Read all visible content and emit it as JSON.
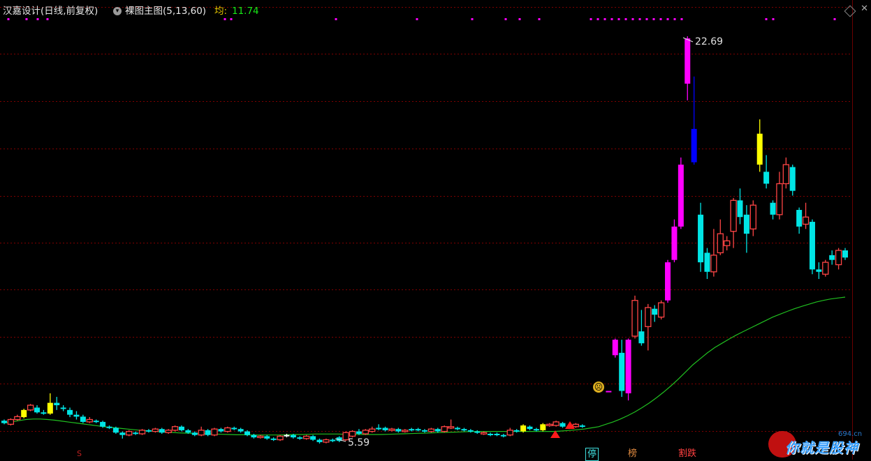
{
  "header": {
    "title": "汉嘉设计(日线,前复权)",
    "indicator_name": "裸图主图(5,13,60)",
    "avg_label": "均:",
    "avg_value": "11.74"
  },
  "annotations": {
    "high_price": "22.69",
    "low_price": "5.59"
  },
  "signal_tags": {
    "ting": "停",
    "bang": "榜",
    "jie": "割跌",
    "s": "S"
  },
  "watermark": {
    "url": "694.cn",
    "text": "你就是股神"
  },
  "colors": {
    "background": "#000000",
    "up": "#ff4545",
    "down": "#00e5e5",
    "limit_up": "#ff00ff",
    "special_yellow": "#ffff00",
    "special_blue": "#0000ff",
    "ma_line": "#20c020",
    "grid": "#800000"
  },
  "chart_data": {
    "type": "candlestick",
    "price_high": 22.69,
    "price_low": 5.59,
    "ma_last": 11.74,
    "candles": [
      {
        "o": 6.55,
        "c": 6.45,
        "h": 6.6,
        "l": 6.4,
        "k": "d"
      },
      {
        "o": 6.4,
        "c": 6.6,
        "h": 6.65,
        "l": 6.35,
        "k": "u"
      },
      {
        "o": 6.6,
        "c": 6.72,
        "h": 6.8,
        "l": 6.55,
        "k": "u"
      },
      {
        "o": 6.7,
        "c": 7.0,
        "h": 7.05,
        "l": 6.65,
        "k": "y"
      },
      {
        "o": 7.0,
        "c": 7.2,
        "h": 7.25,
        "l": 6.95,
        "k": "u"
      },
      {
        "o": 7.1,
        "c": 6.9,
        "h": 7.2,
        "l": 6.85,
        "k": "d"
      },
      {
        "o": 6.9,
        "c": 6.85,
        "h": 7.0,
        "l": 6.8,
        "k": "d"
      },
      {
        "o": 6.85,
        "c": 7.3,
        "h": 7.7,
        "l": 6.8,
        "k": "y"
      },
      {
        "o": 7.3,
        "c": 7.2,
        "h": 7.55,
        "l": 7.0,
        "k": "d"
      },
      {
        "o": 7.1,
        "c": 7.05,
        "h": 7.2,
        "l": 6.95,
        "k": "d"
      },
      {
        "o": 7.0,
        "c": 6.8,
        "h": 7.1,
        "l": 6.7,
        "k": "d"
      },
      {
        "o": 6.8,
        "c": 6.72,
        "h": 6.95,
        "l": 6.6,
        "k": "d"
      },
      {
        "o": 6.72,
        "c": 6.5,
        "h": 6.8,
        "l": 6.45,
        "k": "d"
      },
      {
        "o": 6.5,
        "c": 6.6,
        "h": 6.7,
        "l": 6.45,
        "k": "u"
      },
      {
        "o": 6.55,
        "c": 6.5,
        "h": 6.6,
        "l": 6.45,
        "k": "d"
      },
      {
        "o": 6.5,
        "c": 6.3,
        "h": 6.55,
        "l": 6.25,
        "k": "d"
      },
      {
        "o": 6.3,
        "c": 6.25,
        "h": 6.35,
        "l": 6.2,
        "k": "d"
      },
      {
        "o": 6.25,
        "c": 6.05,
        "h": 6.3,
        "l": 6.0,
        "k": "d"
      },
      {
        "o": 6.05,
        "c": 5.95,
        "h": 6.1,
        "l": 5.8,
        "k": "d"
      },
      {
        "o": 5.95,
        "c": 6.1,
        "h": 6.15,
        "l": 5.9,
        "k": "u"
      },
      {
        "o": 6.05,
        "c": 6.0,
        "h": 6.1,
        "l": 5.95,
        "k": "d"
      },
      {
        "o": 6.0,
        "c": 6.15,
        "h": 6.2,
        "l": 5.95,
        "k": "u"
      },
      {
        "o": 6.15,
        "c": 6.1,
        "h": 6.2,
        "l": 6.05,
        "k": "d"
      },
      {
        "o": 6.1,
        "c": 6.2,
        "h": 6.25,
        "l": 6.05,
        "k": "u"
      },
      {
        "o": 6.2,
        "c": 6.05,
        "h": 6.25,
        "l": 6.0,
        "k": "d"
      },
      {
        "o": 6.05,
        "c": 6.15,
        "h": 6.2,
        "l": 6.0,
        "k": "u"
      },
      {
        "o": 6.15,
        "c": 6.3,
        "h": 6.35,
        "l": 6.1,
        "k": "u"
      },
      {
        "o": 6.3,
        "c": 6.15,
        "h": 6.35,
        "l": 6.1,
        "k": "d"
      },
      {
        "o": 6.15,
        "c": 6.05,
        "h": 6.2,
        "l": 6.0,
        "k": "d"
      },
      {
        "o": 6.05,
        "c": 5.95,
        "h": 6.1,
        "l": 5.9,
        "k": "d"
      },
      {
        "o": 5.95,
        "c": 6.15,
        "h": 6.3,
        "l": 5.9,
        "k": "u"
      },
      {
        "o": 6.15,
        "c": 5.95,
        "h": 6.2,
        "l": 5.9,
        "k": "d"
      },
      {
        "o": 5.95,
        "c": 6.2,
        "h": 6.25,
        "l": 5.9,
        "k": "u"
      },
      {
        "o": 6.2,
        "c": 6.1,
        "h": 6.25,
        "l": 6.05,
        "k": "d"
      },
      {
        "o": 6.1,
        "c": 6.25,
        "h": 6.3,
        "l": 6.05,
        "k": "u"
      },
      {
        "o": 6.25,
        "c": 6.2,
        "h": 6.3,
        "l": 6.15,
        "k": "d"
      },
      {
        "o": 6.2,
        "c": 6.1,
        "h": 6.25,
        "l": 6.05,
        "k": "d"
      },
      {
        "o": 6.1,
        "c": 5.95,
        "h": 6.15,
        "l": 5.9,
        "k": "d"
      },
      {
        "o": 5.95,
        "c": 5.85,
        "h": 6.0,
        "l": 5.8,
        "k": "d"
      },
      {
        "o": 5.85,
        "c": 5.9,
        "h": 5.95,
        "l": 5.8,
        "k": "u"
      },
      {
        "o": 5.9,
        "c": 5.8,
        "h": 5.95,
        "l": 5.75,
        "k": "d"
      },
      {
        "o": 5.8,
        "c": 5.75,
        "h": 5.85,
        "l": 5.7,
        "k": "d"
      },
      {
        "o": 5.75,
        "c": 5.9,
        "h": 5.95,
        "l": 5.7,
        "k": "u"
      },
      {
        "o": 5.9,
        "c": 5.95,
        "h": 6.0,
        "l": 5.85,
        "k": "w"
      },
      {
        "o": 5.95,
        "c": 5.85,
        "h": 6.0,
        "l": 5.8,
        "k": "d"
      },
      {
        "o": 5.85,
        "c": 5.8,
        "h": 5.9,
        "l": 5.75,
        "k": "d"
      },
      {
        "o": 5.8,
        "c": 5.9,
        "h": 5.95,
        "l": 5.75,
        "k": "u"
      },
      {
        "o": 5.9,
        "c": 5.75,
        "h": 5.95,
        "l": 5.7,
        "k": "d"
      },
      {
        "o": 5.75,
        "c": 5.65,
        "h": 5.8,
        "l": 5.59,
        "k": "d"
      },
      {
        "o": 5.65,
        "c": 5.75,
        "h": 5.8,
        "l": 5.6,
        "k": "u"
      },
      {
        "o": 5.75,
        "c": 5.7,
        "h": 5.8,
        "l": 5.65,
        "k": "d"
      },
      {
        "o": 5.7,
        "c": 5.85,
        "h": 5.9,
        "l": 5.65,
        "k": "d"
      },
      {
        "o": 5.75,
        "c": 6.05,
        "h": 6.1,
        "l": 5.7,
        "k": "u"
      },
      {
        "o": 5.9,
        "c": 6.1,
        "h": 6.15,
        "l": 5.85,
        "k": "u"
      },
      {
        "o": 6.1,
        "c": 6.0,
        "h": 6.2,
        "l": 5.95,
        "k": "d"
      },
      {
        "o": 6.0,
        "c": 6.15,
        "h": 6.2,
        "l": 5.95,
        "k": "u"
      },
      {
        "o": 6.1,
        "c": 6.2,
        "h": 6.3,
        "l": 6.05,
        "k": "u"
      },
      {
        "o": 6.2,
        "c": 6.25,
        "h": 6.4,
        "l": 6.15,
        "k": "d"
      },
      {
        "o": 6.25,
        "c": 6.15,
        "h": 6.3,
        "l": 6.1,
        "k": "d"
      },
      {
        "o": 6.15,
        "c": 6.2,
        "h": 6.25,
        "l": 6.1,
        "k": "u"
      },
      {
        "o": 6.2,
        "c": 6.1,
        "h": 6.25,
        "l": 6.05,
        "k": "d"
      },
      {
        "o": 6.1,
        "c": 6.15,
        "h": 6.2,
        "l": 6.05,
        "k": "u"
      },
      {
        "o": 6.15,
        "c": 6.2,
        "h": 6.25,
        "l": 6.1,
        "k": "d"
      },
      {
        "o": 6.2,
        "c": 6.15,
        "h": 6.25,
        "l": 6.1,
        "k": "d"
      },
      {
        "o": 6.15,
        "c": 6.1,
        "h": 6.2,
        "l": 6.05,
        "k": "d"
      },
      {
        "o": 6.1,
        "c": 6.2,
        "h": 6.25,
        "l": 6.05,
        "k": "u"
      },
      {
        "o": 6.2,
        "c": 6.1,
        "h": 6.25,
        "l": 6.05,
        "k": "d"
      },
      {
        "o": 6.1,
        "c": 6.3,
        "h": 6.35,
        "l": 6.05,
        "k": "u"
      },
      {
        "o": 6.3,
        "c": 6.25,
        "h": 6.6,
        "l": 6.2,
        "k": "u"
      },
      {
        "o": 6.25,
        "c": 6.2,
        "h": 6.3,
        "l": 6.15,
        "k": "d"
      },
      {
        "o": 6.2,
        "c": 6.15,
        "h": 6.25,
        "l": 6.1,
        "k": "d"
      },
      {
        "o": 6.15,
        "c": 6.1,
        "h": 6.2,
        "l": 6.05,
        "k": "d"
      },
      {
        "o": 6.1,
        "c": 6.05,
        "h": 6.15,
        "l": 6.0,
        "k": "d"
      },
      {
        "o": 6.05,
        "c": 6.0,
        "h": 6.1,
        "l": 5.95,
        "k": "u"
      },
      {
        "o": 6.0,
        "c": 5.95,
        "h": 6.05,
        "l": 5.9,
        "k": "d"
      },
      {
        "o": 5.95,
        "c": 6.0,
        "h": 6.05,
        "l": 5.9,
        "k": "d"
      },
      {
        "o": 5.95,
        "c": 5.92,
        "h": 6.0,
        "l": 5.85,
        "k": "d"
      },
      {
        "o": 5.95,
        "c": 6.15,
        "h": 6.25,
        "l": 5.9,
        "k": "u"
      },
      {
        "o": 6.15,
        "c": 6.1,
        "h": 6.2,
        "l": 6.05,
        "k": "d"
      },
      {
        "o": 6.1,
        "c": 6.35,
        "h": 6.4,
        "l": 6.05,
        "k": "y"
      },
      {
        "o": 6.3,
        "c": 6.2,
        "h": 6.35,
        "l": 6.15,
        "k": "d"
      },
      {
        "o": 6.2,
        "c": 6.15,
        "h": 6.25,
        "l": 6.1,
        "k": "d"
      },
      {
        "o": 6.15,
        "c": 6.4,
        "h": 6.45,
        "l": 6.1,
        "k": "y"
      },
      {
        "o": 6.4,
        "c": 6.35,
        "h": 6.45,
        "l": 6.3,
        "k": "u"
      },
      {
        "o": 6.35,
        "c": 6.5,
        "h": 6.55,
        "l": 6.3,
        "k": "u"
      },
      {
        "o": 6.45,
        "c": 6.3,
        "h": 6.5,
        "l": 6.25,
        "k": "d"
      },
      {
        "o": 6.3,
        "c": 6.25,
        "h": 6.35,
        "l": 6.2,
        "k": "d"
      },
      {
        "o": 6.3,
        "c": 6.4,
        "h": 6.45,
        "l": 6.25,
        "k": "u"
      },
      {
        "o": 6.35,
        "c": 6.3,
        "h": 6.4,
        "l": 6.25,
        "k": "d"
      },
      {
        "o": null,
        "c": null,
        "h": null,
        "l": null,
        "k": "gap"
      },
      {
        "o": null,
        "c": null,
        "h": null,
        "l": null,
        "k": "gap"
      },
      {
        "o": null,
        "c": null,
        "h": null,
        "l": null,
        "k": "gap"
      },
      {
        "o": 7.8,
        "c": 7.8,
        "h": 7.8,
        "l": 7.8,
        "k": "m"
      },
      {
        "o": 9.3,
        "c": 9.95,
        "h": 10.0,
        "l": 9.2,
        "k": "m"
      },
      {
        "o": 9.4,
        "c": 7.8,
        "h": 9.95,
        "l": 7.55,
        "k": "d"
      },
      {
        "o": 7.7,
        "c": 9.95,
        "h": 10.0,
        "l": 7.4,
        "k": "m"
      },
      {
        "o": 10.1,
        "c": 11.6,
        "h": 11.8,
        "l": 10.0,
        "k": "u"
      },
      {
        "o": 9.8,
        "c": 10.3,
        "h": 11.2,
        "l": 9.7,
        "k": "d"
      },
      {
        "o": 10.5,
        "c": 11.3,
        "h": 11.45,
        "l": 9.5,
        "k": "u"
      },
      {
        "o": 11.0,
        "c": 11.25,
        "h": 11.4,
        "l": 10.7,
        "k": "d"
      },
      {
        "o": 10.9,
        "c": 11.5,
        "h": 11.6,
        "l": 10.8,
        "k": "u"
      },
      {
        "o": 11.6,
        "c": 13.2,
        "h": 13.3,
        "l": 11.5,
        "k": "m"
      },
      {
        "o": 13.3,
        "c": 14.7,
        "h": 15.0,
        "l": 13.2,
        "k": "m"
      },
      {
        "o": 14.7,
        "c": 17.3,
        "h": 17.6,
        "l": 14.6,
        "k": "m"
      },
      {
        "o": 20.7,
        "c": 22.6,
        "h": 22.69,
        "l": 20.0,
        "k": "m"
      },
      {
        "o": 18.8,
        "c": 17.4,
        "h": 21.0,
        "l": 17.3,
        "k": "b"
      },
      {
        "o": 15.2,
        "c": 13.2,
        "h": 15.7,
        "l": 12.8,
        "k": "d"
      },
      {
        "o": 13.6,
        "c": 12.8,
        "h": 13.8,
        "l": 12.5,
        "k": "d"
      },
      {
        "o": 12.8,
        "c": 13.5,
        "h": 14.6,
        "l": 12.6,
        "k": "u"
      },
      {
        "o": 13.6,
        "c": 14.4,
        "h": 15.0,
        "l": 13.5,
        "k": "u"
      },
      {
        "o": 13.9,
        "c": 14.1,
        "h": 14.3,
        "l": 13.7,
        "k": "u"
      },
      {
        "o": 14.5,
        "c": 15.8,
        "h": 15.9,
        "l": 13.8,
        "k": "u"
      },
      {
        "o": 15.8,
        "c": 15.1,
        "h": 16.3,
        "l": 14.8,
        "k": "d"
      },
      {
        "o": 15.2,
        "c": 14.4,
        "h": 15.6,
        "l": 13.6,
        "k": "d"
      },
      {
        "o": 14.6,
        "c": 15.6,
        "h": 15.8,
        "l": 14.3,
        "k": "u"
      },
      {
        "o": 17.3,
        "c": 18.6,
        "h": 19.2,
        "l": 17.0,
        "k": "y"
      },
      {
        "o": 17.0,
        "c": 16.5,
        "h": 17.7,
        "l": 16.3,
        "k": "d"
      },
      {
        "o": 15.7,
        "c": 15.2,
        "h": 15.8,
        "l": 15.0,
        "k": "d"
      },
      {
        "o": 15.2,
        "c": 16.5,
        "h": 17.0,
        "l": 15.0,
        "k": "u"
      },
      {
        "o": 16.5,
        "c": 17.3,
        "h": 17.6,
        "l": 16.3,
        "k": "u"
      },
      {
        "o": 17.2,
        "c": 16.2,
        "h": 17.3,
        "l": 16.0,
        "k": "d"
      },
      {
        "o": 15.4,
        "c": 14.7,
        "h": 15.5,
        "l": 14.4,
        "k": "d"
      },
      {
        "o": 14.8,
        "c": 15.1,
        "h": 15.7,
        "l": 14.6,
        "k": "u"
      },
      {
        "o": 14.9,
        "c": 12.9,
        "h": 15.0,
        "l": 12.7,
        "k": "d"
      },
      {
        "o": 12.9,
        "c": 12.8,
        "h": 13.2,
        "l": 12.5,
        "k": "d"
      },
      {
        "o": 12.7,
        "c": 13.2,
        "h": 13.3,
        "l": 12.6,
        "k": "u"
      },
      {
        "o": 13.3,
        "c": 13.5,
        "h": 13.7,
        "l": 13.1,
        "k": "d"
      },
      {
        "o": 13.1,
        "c": 13.7,
        "h": 13.8,
        "l": 12.9,
        "k": "u"
      },
      {
        "o": 13.7,
        "c": 13.4,
        "h": 13.8,
        "l": 13.3,
        "k": "d"
      }
    ],
    "ma": [
      6.45,
      6.5,
      6.55,
      6.6,
      6.62,
      6.62,
      6.6,
      6.57,
      6.53,
      6.49,
      6.45,
      6.41,
      6.37,
      6.33,
      6.29,
      6.26,
      6.23,
      6.2,
      6.17,
      6.14,
      6.12,
      6.1,
      6.08,
      6.06,
      6.04,
      6.03,
      6.02,
      6.01,
      6.0,
      5.99,
      5.98,
      5.97,
      5.96,
      5.96,
      5.95,
      5.95,
      5.95,
      5.95,
      5.95,
      5.96,
      5.97,
      5.97,
      5.98,
      5.99,
      5.99,
      5.99,
      5.99,
      5.98,
      5.98,
      5.97,
      5.97,
      5.97,
      5.97,
      5.98,
      5.99,
      6.0,
      6.01,
      6.02,
      6.03,
      6.04,
      6.05,
      6.06,
      6.07,
      6.08,
      6.09,
      6.1,
      6.1,
      6.1,
      6.1,
      6.1,
      6.1,
      6.1,
      6.1,
      6.1,
      6.1,
      6.1,
      6.1,
      6.12,
      6.14,
      6.17,
      6.2,
      6.25,
      6.3,
      6.4,
      6.5,
      6.62,
      6.76,
      6.92,
      7.1,
      7.3,
      7.52,
      7.76,
      8.02,
      8.3,
      8.6,
      8.9,
      9.15,
      9.4,
      9.62,
      9.8,
      9.98,
      10.15,
      10.3,
      10.45,
      10.6,
      10.75,
      10.9,
      11.02,
      11.14,
      11.25,
      11.35,
      11.44,
      11.53,
      11.6,
      11.66,
      11.7,
      11.74
    ]
  }
}
